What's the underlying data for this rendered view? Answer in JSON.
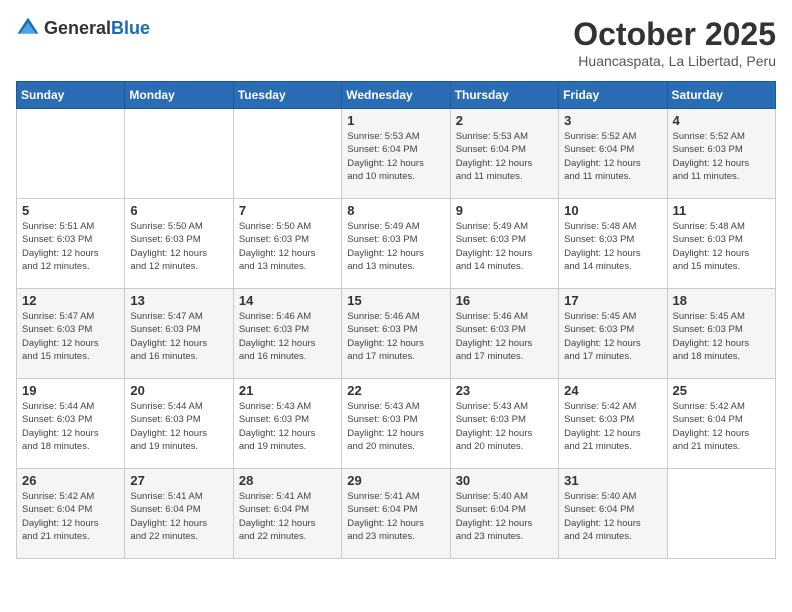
{
  "header": {
    "logo_general": "General",
    "logo_blue": "Blue",
    "month_year": "October 2025",
    "location": "Huancaspata, La Libertad, Peru"
  },
  "days_of_week": [
    "Sunday",
    "Monday",
    "Tuesday",
    "Wednesday",
    "Thursday",
    "Friday",
    "Saturday"
  ],
  "weeks": [
    [
      {
        "day": "",
        "info": ""
      },
      {
        "day": "",
        "info": ""
      },
      {
        "day": "",
        "info": ""
      },
      {
        "day": "1",
        "info": "Sunrise: 5:53 AM\nSunset: 6:04 PM\nDaylight: 12 hours\nand 10 minutes."
      },
      {
        "day": "2",
        "info": "Sunrise: 5:53 AM\nSunset: 6:04 PM\nDaylight: 12 hours\nand 11 minutes."
      },
      {
        "day": "3",
        "info": "Sunrise: 5:52 AM\nSunset: 6:04 PM\nDaylight: 12 hours\nand 11 minutes."
      },
      {
        "day": "4",
        "info": "Sunrise: 5:52 AM\nSunset: 6:03 PM\nDaylight: 12 hours\nand 11 minutes."
      }
    ],
    [
      {
        "day": "5",
        "info": "Sunrise: 5:51 AM\nSunset: 6:03 PM\nDaylight: 12 hours\nand 12 minutes."
      },
      {
        "day": "6",
        "info": "Sunrise: 5:50 AM\nSunset: 6:03 PM\nDaylight: 12 hours\nand 12 minutes."
      },
      {
        "day": "7",
        "info": "Sunrise: 5:50 AM\nSunset: 6:03 PM\nDaylight: 12 hours\nand 13 minutes."
      },
      {
        "day": "8",
        "info": "Sunrise: 5:49 AM\nSunset: 6:03 PM\nDaylight: 12 hours\nand 13 minutes."
      },
      {
        "day": "9",
        "info": "Sunrise: 5:49 AM\nSunset: 6:03 PM\nDaylight: 12 hours\nand 14 minutes."
      },
      {
        "day": "10",
        "info": "Sunrise: 5:48 AM\nSunset: 6:03 PM\nDaylight: 12 hours\nand 14 minutes."
      },
      {
        "day": "11",
        "info": "Sunrise: 5:48 AM\nSunset: 6:03 PM\nDaylight: 12 hours\nand 15 minutes."
      }
    ],
    [
      {
        "day": "12",
        "info": "Sunrise: 5:47 AM\nSunset: 6:03 PM\nDaylight: 12 hours\nand 15 minutes."
      },
      {
        "day": "13",
        "info": "Sunrise: 5:47 AM\nSunset: 6:03 PM\nDaylight: 12 hours\nand 16 minutes."
      },
      {
        "day": "14",
        "info": "Sunrise: 5:46 AM\nSunset: 6:03 PM\nDaylight: 12 hours\nand 16 minutes."
      },
      {
        "day": "15",
        "info": "Sunrise: 5:46 AM\nSunset: 6:03 PM\nDaylight: 12 hours\nand 17 minutes."
      },
      {
        "day": "16",
        "info": "Sunrise: 5:46 AM\nSunset: 6:03 PM\nDaylight: 12 hours\nand 17 minutes."
      },
      {
        "day": "17",
        "info": "Sunrise: 5:45 AM\nSunset: 6:03 PM\nDaylight: 12 hours\nand 17 minutes."
      },
      {
        "day": "18",
        "info": "Sunrise: 5:45 AM\nSunset: 6:03 PM\nDaylight: 12 hours\nand 18 minutes."
      }
    ],
    [
      {
        "day": "19",
        "info": "Sunrise: 5:44 AM\nSunset: 6:03 PM\nDaylight: 12 hours\nand 18 minutes."
      },
      {
        "day": "20",
        "info": "Sunrise: 5:44 AM\nSunset: 6:03 PM\nDaylight: 12 hours\nand 19 minutes."
      },
      {
        "day": "21",
        "info": "Sunrise: 5:43 AM\nSunset: 6:03 PM\nDaylight: 12 hours\nand 19 minutes."
      },
      {
        "day": "22",
        "info": "Sunrise: 5:43 AM\nSunset: 6:03 PM\nDaylight: 12 hours\nand 20 minutes."
      },
      {
        "day": "23",
        "info": "Sunrise: 5:43 AM\nSunset: 6:03 PM\nDaylight: 12 hours\nand 20 minutes."
      },
      {
        "day": "24",
        "info": "Sunrise: 5:42 AM\nSunset: 6:03 PM\nDaylight: 12 hours\nand 21 minutes."
      },
      {
        "day": "25",
        "info": "Sunrise: 5:42 AM\nSunset: 6:04 PM\nDaylight: 12 hours\nand 21 minutes."
      }
    ],
    [
      {
        "day": "26",
        "info": "Sunrise: 5:42 AM\nSunset: 6:04 PM\nDaylight: 12 hours\nand 21 minutes."
      },
      {
        "day": "27",
        "info": "Sunrise: 5:41 AM\nSunset: 6:04 PM\nDaylight: 12 hours\nand 22 minutes."
      },
      {
        "day": "28",
        "info": "Sunrise: 5:41 AM\nSunset: 6:04 PM\nDaylight: 12 hours\nand 22 minutes."
      },
      {
        "day": "29",
        "info": "Sunrise: 5:41 AM\nSunset: 6:04 PM\nDaylight: 12 hours\nand 23 minutes."
      },
      {
        "day": "30",
        "info": "Sunrise: 5:40 AM\nSunset: 6:04 PM\nDaylight: 12 hours\nand 23 minutes."
      },
      {
        "day": "31",
        "info": "Sunrise: 5:40 AM\nSunset: 6:04 PM\nDaylight: 12 hours\nand 24 minutes."
      },
      {
        "day": "",
        "info": ""
      }
    ]
  ]
}
